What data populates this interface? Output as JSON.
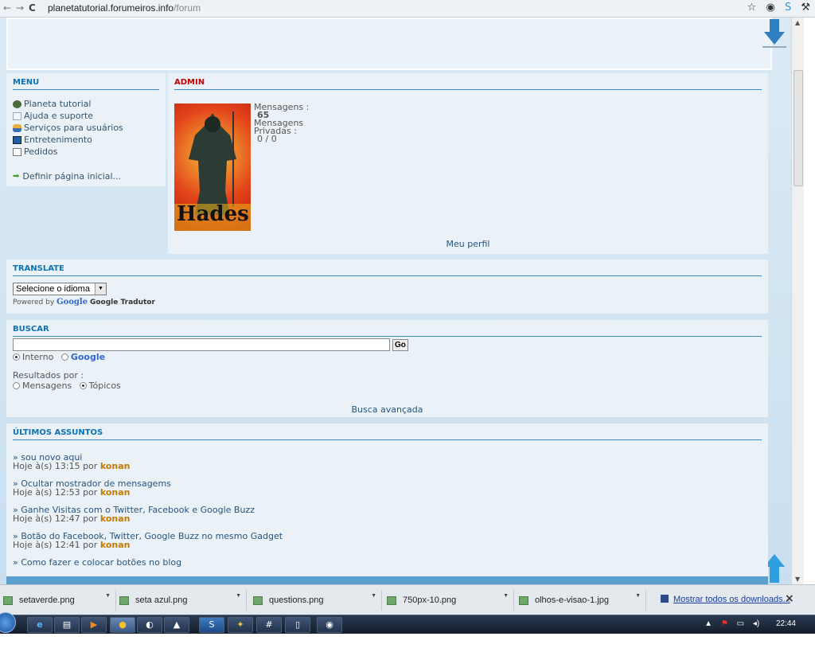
{
  "browser": {
    "url_host": "planetatutorial.forumeiros.info",
    "url_path": "/forum"
  },
  "menu": {
    "title": "MENU",
    "items": [
      {
        "label": "Planeta tutorial",
        "icon": "globe-icon"
      },
      {
        "label": "Ajuda e suporte",
        "icon": "search-icon"
      },
      {
        "label": "Serviços para usuários",
        "icon": "user-icon"
      },
      {
        "label": "Entretenimento",
        "icon": "monitor-icon"
      },
      {
        "label": "Pedidos",
        "icon": "edit-icon"
      }
    ],
    "homepage_link": "Definir página inicial..."
  },
  "admin": {
    "title": "ADMIN",
    "avatar_text": "Hades",
    "messages_label": "Mensagens :",
    "messages_count": "65",
    "private_label_1": "Mensagens",
    "private_label_2": "Privadas :",
    "private_count": "0 / 0",
    "profile_link": "Meu perfil"
  },
  "translate": {
    "title": "TRANSLATE",
    "select_value": "Selecione o idioma",
    "powered_prefix": "Powered by",
    "powered_google": "Google",
    "powered_suffix": "Google Tradutor"
  },
  "search": {
    "title": "BUSCAR",
    "input_value": "",
    "go_label": "Go",
    "opt_internal": "Interno",
    "opt_google": "Google",
    "results_by": "Resultados por :",
    "opt_messages": "Mensagens",
    "opt_topics": "Tópicos",
    "advanced_link": "Busca avançada"
  },
  "latest": {
    "title": "ÚLTIMOS ASSUNTOS",
    "topics": [
      {
        "title": "» sou novo aqui",
        "date": "Hoje à(s) 13:15 por",
        "user": "konan"
      },
      {
        "title": "» Ocultar mostrador de mensagems",
        "date": "Hoje à(s) 12:53 por",
        "user": "konan"
      },
      {
        "title": "» Ganhe Visitas com o Twitter, Facebook e Google Buzz",
        "date": "Hoje à(s) 12:47 por",
        "user": "konan"
      },
      {
        "title": "» Botão do Facebook, Twitter, Google Buzz no mesmo Gadget",
        "date": "Hoje à(s) 12:41 por",
        "user": "konan"
      },
      {
        "title": "» Como fazer e colocar botões no blog",
        "date": "",
        "user": ""
      }
    ]
  },
  "downloads": {
    "items": [
      {
        "name": "setaverde.png"
      },
      {
        "name": "seta azul.png"
      },
      {
        "name": "questions.png"
      },
      {
        "name": "750px-10.png"
      },
      {
        "name": "olhos-e-visao-1.jpg"
      }
    ],
    "show_all": "Mostrar todos os downloads...",
    "close": "×"
  },
  "taskbar": {
    "clock": "22:44"
  },
  "colors": {
    "heading": "#0a73b5",
    "admin_heading": "#c00000",
    "username": "#c27b00",
    "page_bg": "#c9dff0"
  }
}
